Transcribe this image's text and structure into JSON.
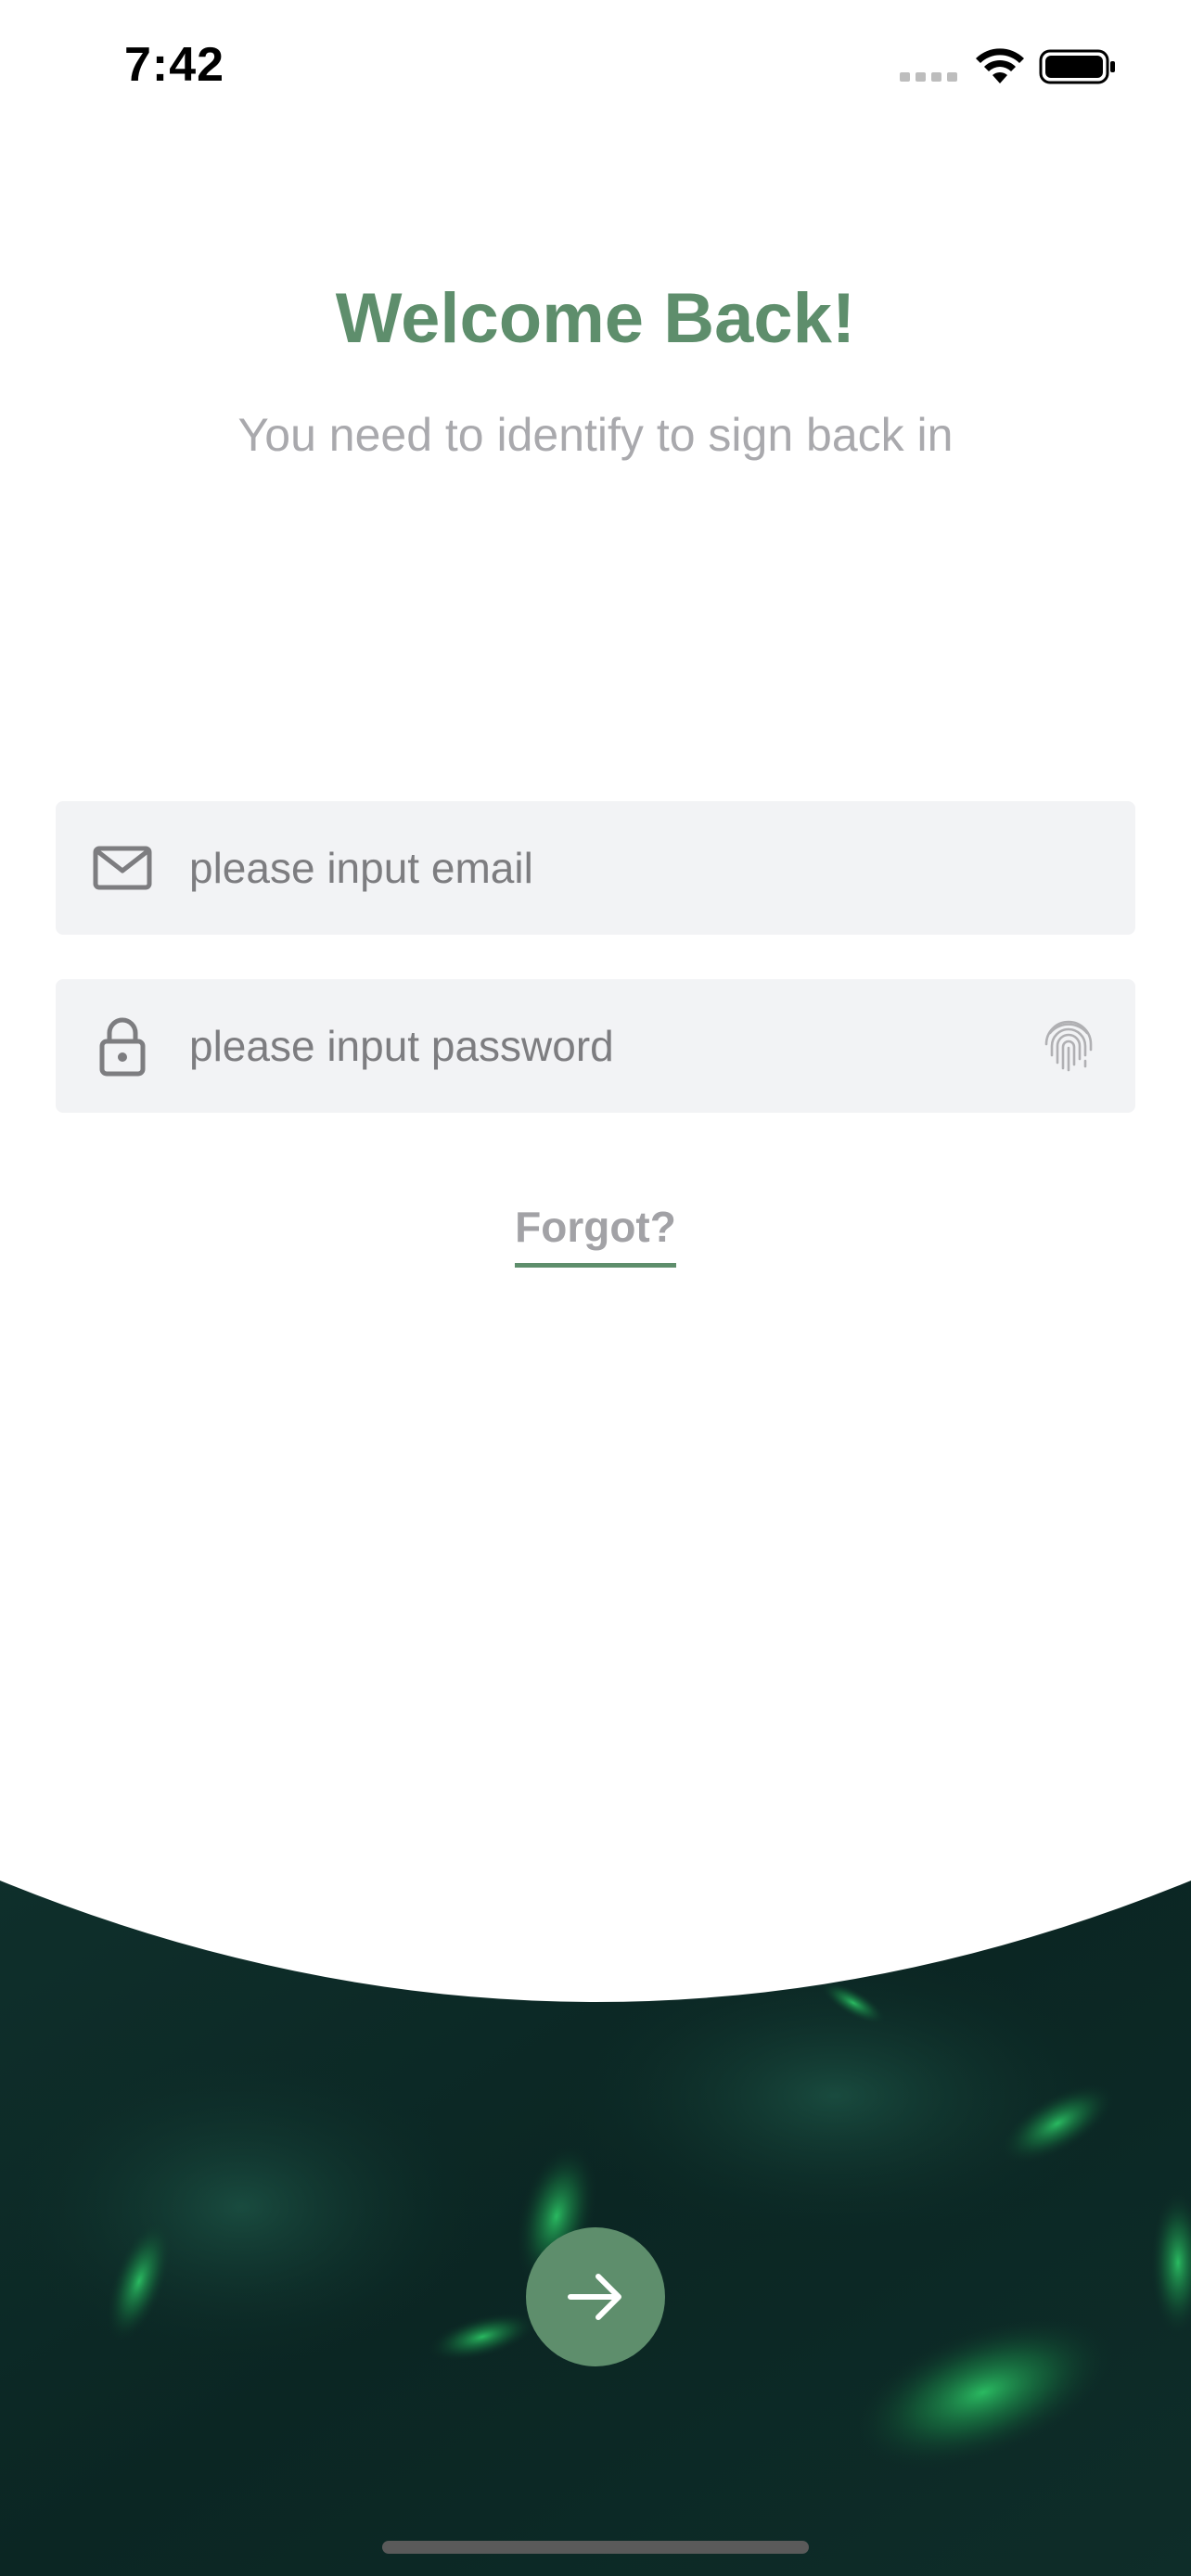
{
  "status_bar": {
    "time": "7:42"
  },
  "header": {
    "title": "Welcome Back!",
    "subtitle": "You need to identify to sign back in"
  },
  "form": {
    "email_placeholder": "please input email",
    "password_placeholder": "please input password",
    "forgot_label": "Forgot?"
  },
  "icons": {
    "email": "mail-icon",
    "password": "lock-icon",
    "biometric": "fingerprint-icon",
    "submit": "arrow-right-icon"
  },
  "colors": {
    "accent": "#5e8e6c",
    "field_bg": "#f2f3f5",
    "bottom_bg": "#0d2a26",
    "subtitle": "#a9a9ad"
  }
}
